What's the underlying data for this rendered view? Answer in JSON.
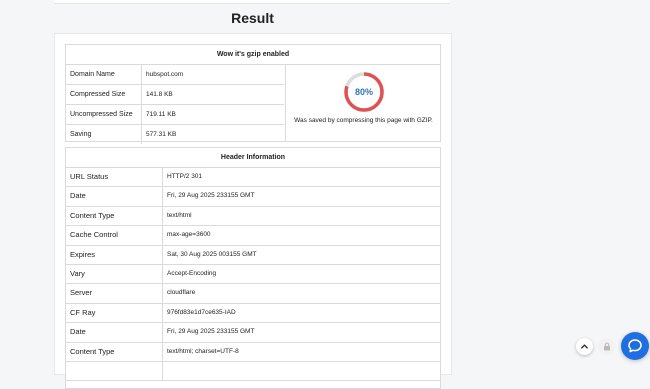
{
  "title": "Result",
  "gzip": {
    "heading": "Wow it's gzip enabled",
    "rows": [
      {
        "key": "Domain Name",
        "value": "hubspot.com"
      },
      {
        "key": "Compressed Size",
        "value": "141.8 KB"
      },
      {
        "key": "Uncompressed Size",
        "value": "719.11 KB"
      },
      {
        "key": "Saving",
        "value": "577.31 KB"
      }
    ],
    "percent_label": "80%",
    "percent_value": 0.8,
    "saved_text": "Was saved by compressing this page with GZIP.",
    "ring_color": "#e05252",
    "percent_color": "#2e75b6"
  },
  "header_info": {
    "heading": "Header Information",
    "rows": [
      {
        "key": "URL Status",
        "value": "HTTP/2 301"
      },
      {
        "key": "Date",
        "value": "Fri, 29 Aug 2025 233155 GMT"
      },
      {
        "key": "Content Type",
        "value": "text/html"
      },
      {
        "key": "Cache Control",
        "value": "max-age=3600"
      },
      {
        "key": "Expires",
        "value": "Sat, 30 Aug 2025 003155 GMT"
      },
      {
        "key": "Vary",
        "value": "Accept-Encoding"
      },
      {
        "key": "Server",
        "value": "cloudflare"
      },
      {
        "key": "CF Ray",
        "value": "976fd83e1d7ce635-IAD"
      },
      {
        "key": "Date",
        "value": "Fri, 29 Aug 2025 233155 GMT"
      },
      {
        "key": "Content Type",
        "value": "text/html; charset=UTF-8"
      },
      {
        "key": "",
        "value": ""
      }
    ]
  },
  "icons": {
    "scroll_top": "chevron-up-icon",
    "lock": "lock-icon",
    "chat": "chat-icon"
  },
  "colors": {
    "chat_button": "#1f6fe0"
  }
}
